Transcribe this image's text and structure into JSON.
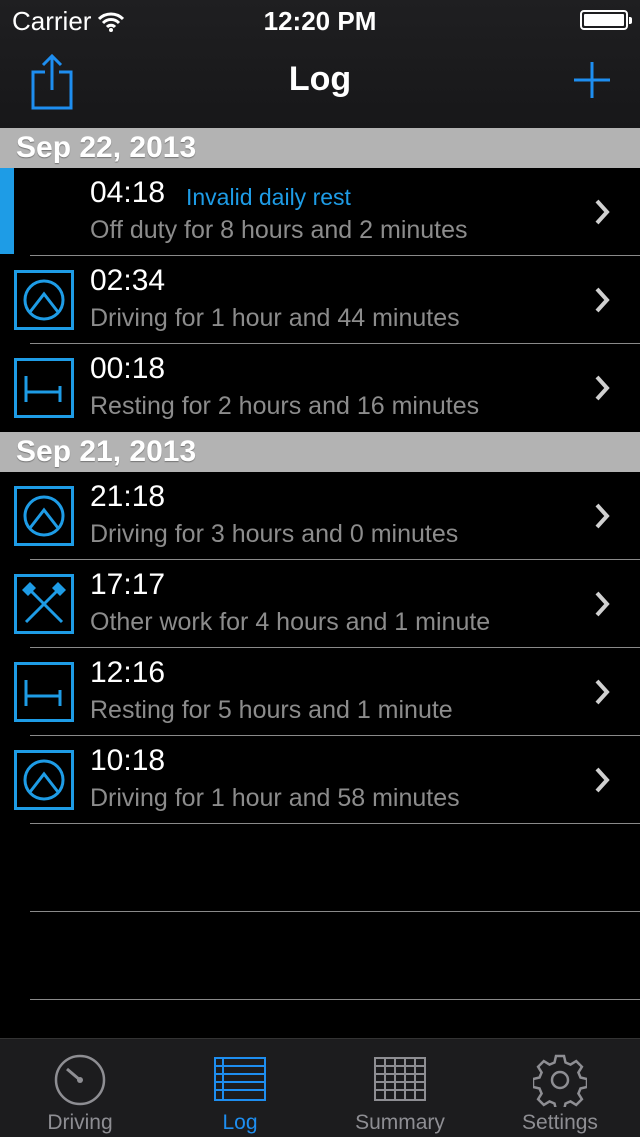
{
  "status_bar": {
    "carrier": "Carrier",
    "time": "12:20 PM"
  },
  "nav": {
    "title": "Log",
    "share_icon": "share-icon",
    "add_icon": "plus-icon"
  },
  "colors": {
    "accent": "#1e9ce6",
    "section_header": "#b3b3b3",
    "subtitle": "#8c8c8c"
  },
  "sections": [
    {
      "date": "Sep 22, 2013",
      "rows": [
        {
          "time": "04:18",
          "warning": "Invalid daily rest",
          "description": "Off duty for 8 hours and 2 minutes",
          "icon": "off-duty-marker"
        },
        {
          "time": "02:34",
          "warning": "",
          "description": "Driving for 1 hour and 44 minutes",
          "icon": "driving-icon"
        },
        {
          "time": "00:18",
          "warning": "",
          "description": "Resting for 2 hours and 16 minutes",
          "icon": "bed-icon"
        }
      ]
    },
    {
      "date": "Sep 21, 2013",
      "rows": [
        {
          "time": "21:18",
          "warning": "",
          "description": "Driving for 3 hours and 0 minutes",
          "icon": "driving-icon"
        },
        {
          "time": "17:17",
          "warning": "",
          "description": "Other work for 4 hours and 1 minute",
          "icon": "hammers-icon"
        },
        {
          "time": "12:16",
          "warning": "",
          "description": "Resting for 5 hours and 1 minute",
          "icon": "bed-icon"
        },
        {
          "time": "10:18",
          "warning": "",
          "description": "Driving for 1 hour and 58 minutes",
          "icon": "driving-icon"
        }
      ]
    }
  ],
  "tabs": [
    {
      "label": "Driving",
      "icon": "speedometer-icon",
      "active": false
    },
    {
      "label": "Log",
      "icon": "log-icon",
      "active": true
    },
    {
      "label": "Summary",
      "icon": "grid-icon",
      "active": false
    },
    {
      "label": "Settings",
      "icon": "gear-icon",
      "active": false
    }
  ]
}
